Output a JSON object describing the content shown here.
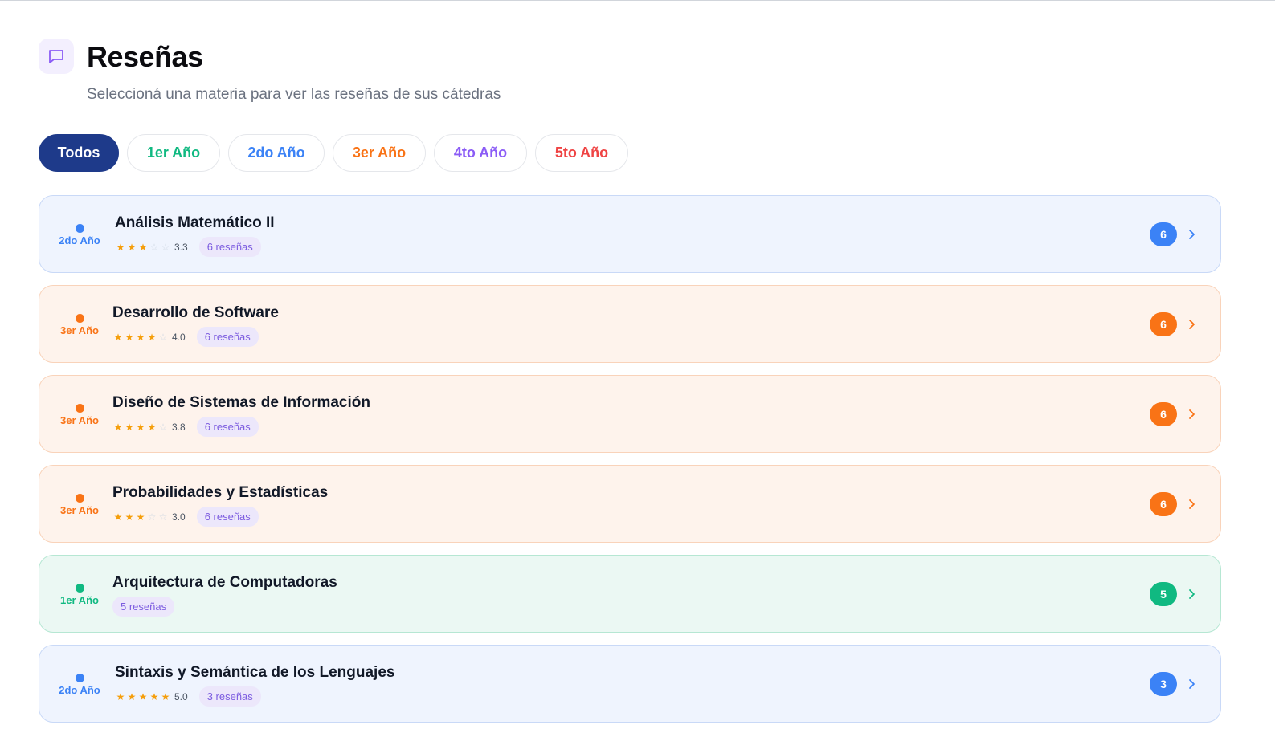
{
  "header": {
    "title": "Reseñas",
    "subtitle": "Seleccioná una materia para ver las reseñas de sus cátedras"
  },
  "filters": [
    {
      "label": "Todos",
      "active": true,
      "color": "#1e3a8a"
    },
    {
      "label": "1er Año",
      "active": false,
      "color": "#10b981"
    },
    {
      "label": "2do Año",
      "active": false,
      "color": "#3b82f6"
    },
    {
      "label": "3er Año",
      "active": false,
      "color": "#f97316"
    },
    {
      "label": "4to Año",
      "active": false,
      "color": "#8b5cf6"
    },
    {
      "label": "5to Año",
      "active": false,
      "color": "#ef4444"
    }
  ],
  "subjects": [
    {
      "name": "Análisis Matemático II",
      "year": "2do Año",
      "rating": 3.3,
      "rating_text": "3.3",
      "stars": 3,
      "reviews": "6 reseñas",
      "count": "6",
      "color": "#3b82f6",
      "bg": "#eff4fe",
      "border": "#c9d9f7"
    },
    {
      "name": "Desarrollo de Software",
      "year": "3er Año",
      "rating": 4.0,
      "rating_text": "4.0",
      "stars": 4,
      "reviews": "6 reseñas",
      "count": "6",
      "color": "#f97316",
      "bg": "#fef3ec",
      "border": "#f9d3ba"
    },
    {
      "name": "Diseño de Sistemas de Información",
      "year": "3er Año",
      "rating": 3.8,
      "rating_text": "3.8",
      "stars": 4,
      "reviews": "6 reseñas",
      "count": "6",
      "color": "#f97316",
      "bg": "#fef3ec",
      "border": "#f9d3ba"
    },
    {
      "name": "Probabilidades y Estadísticas",
      "year": "3er Año",
      "rating": 3.0,
      "rating_text": "3.0",
      "stars": 3,
      "reviews": "6 reseñas",
      "count": "6",
      "color": "#f97316",
      "bg": "#fef3ec",
      "border": "#f9d3ba"
    },
    {
      "name": "Arquitectura de Computadoras",
      "year": "1er Año",
      "rating": null,
      "rating_text": "",
      "stars": 0,
      "reviews": "5 reseñas",
      "count": "5",
      "color": "#10b981",
      "bg": "#ebf8f3",
      "border": "#b6e7d3"
    },
    {
      "name": "Sintaxis y Semántica de los Lenguajes",
      "year": "2do Año",
      "rating": 5.0,
      "rating_text": "5.0",
      "stars": 5,
      "reviews": "3 reseñas",
      "count": "3",
      "color": "#3b82f6",
      "bg": "#eff4fe",
      "border": "#c9d9f7"
    }
  ],
  "icons": {
    "header": "message-square-icon",
    "row_action": "chevron-right-icon",
    "star": "star-icon"
  }
}
